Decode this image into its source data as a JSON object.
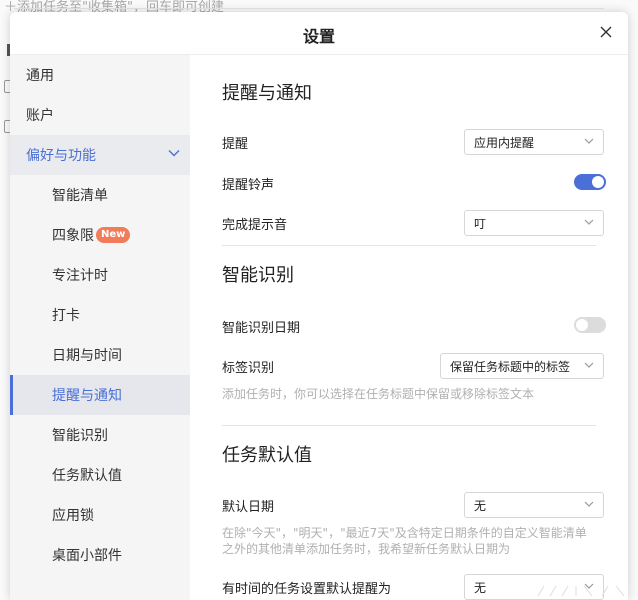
{
  "background": {
    "hint": "＋添加任务至\"收集箱\"，回车即可创建"
  },
  "dialog": {
    "title": "设置"
  },
  "sidebar": {
    "items": [
      {
        "label": "通用"
      },
      {
        "label": "账户"
      },
      {
        "label": "偏好与功能"
      },
      {
        "label": "智能清单"
      },
      {
        "label": "四象限",
        "badge": "New"
      },
      {
        "label": "专注计时"
      },
      {
        "label": "打卡"
      },
      {
        "label": "日期与时间"
      },
      {
        "label": "提醒与通知"
      },
      {
        "label": "智能识别"
      },
      {
        "label": "任务默认值"
      },
      {
        "label": "应用锁"
      },
      {
        "label": "桌面小部件"
      }
    ]
  },
  "sections": {
    "reminder": {
      "title": "提醒与通知",
      "remind_label": "提醒",
      "remind_value": "应用内提醒",
      "ringtone_label": "提醒铃声",
      "ringtone_on": true,
      "done_sound_label": "完成提示音",
      "done_sound_value": "叮"
    },
    "smart": {
      "title": "智能识别",
      "date_label": "智能识别日期",
      "date_on": false,
      "tag_label": "标签识别",
      "tag_value": "保留任务标题中的标签",
      "tag_desc": "添加任务时，你可以选择在任务标题中保留或移除标签文本"
    },
    "defaults": {
      "title": "任务默认值",
      "date_label": "默认日期",
      "date_value": "无",
      "date_desc": "在除\"今天\"，\"明天\"，\"最近7天\"及含特定日期条件的自定义智能清单之外的其他清单添加任务时，我希望新任务默认日期为",
      "timed_label": "有时间的任务设置默认提醒为",
      "timed_value": "无"
    }
  },
  "colors": {
    "accent": "#4a6fd6",
    "badge": "#f07c5a"
  }
}
